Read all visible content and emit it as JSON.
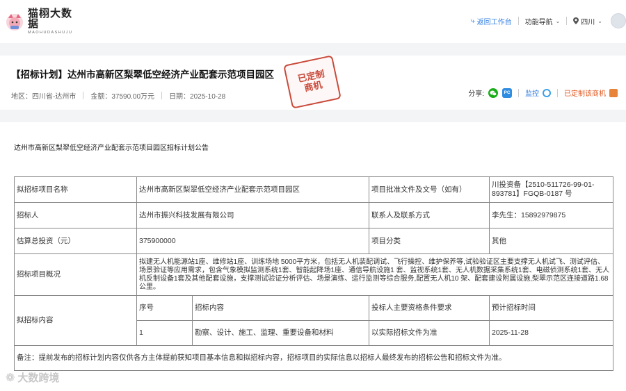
{
  "brand": {
    "name_cn": "猫栩大数据",
    "name_en": "MAOHUDASHUJU"
  },
  "topnav": {
    "back_label": "返回工作台",
    "nav_label": "功能导航",
    "region_label": "四川"
  },
  "project_header": {
    "title": "【招标计划】达州市高新区梨翠低空经济产业配套示范项目园区",
    "stamp_line1": "已定制",
    "stamp_line2": "商机",
    "region": "地区：四川省-达州市",
    "amount": "金额：37590.00万元",
    "date": "日期：2025-10-28",
    "share_label": "分享:",
    "pc_icon_text": "PC",
    "monitor_label": "监控",
    "customized_label": "已定制该商机"
  },
  "notice": {
    "title": "达州市高新区梨翠低空经济产业配套示范项目园区招标计划公告"
  },
  "table": {
    "row1": {
      "label1": "拟招标项目名称",
      "value1": "达州市高新区梨翠低空经济产业配套示范项目园区",
      "label2": "项目批准文件及文号（如有）",
      "value2": "川投资备【2510-511726-99-01-893781】FGQB-0187 号"
    },
    "row2": {
      "label1": "招标人",
      "value1": "达州市振兴科技发展有限公司",
      "label2": "联系人及联系方式",
      "value2": "李先生：15892979875"
    },
    "row3": {
      "label1": "估算总投资（元）",
      "value1": "375900000",
      "label2": "项目分类",
      "value2": "其他"
    },
    "row4": {
      "label": "招标项目概况",
      "value": "拟建无人机能源站1座、维修站1座、训练场地 5000平方米，包括无人机装配调试、飞行操控、维护保养等,试验验证区主要支撑无人机试飞、测试评估、场景验证等应用需求，包含气象模拟监测系统1套、智能起降场1座、通信导航设施1 套、监视系统1套、无人机数据采集系统1套、电磁侦测系统1套、无人机反制设备1套及其他配套设施，支撑测试验证分析评估、场景演练、运行监测等综合服务,配置无人机10 架、配套建设附属设施,梨翠示范区连接道路1.68公里。"
    },
    "row5": {
      "label": "拟招标内容",
      "headers": [
        "序号",
        "招标内容",
        "投标人主要资格条件要求",
        "预计招标时间"
      ],
      "rows": [
        [
          "1",
          "勘察、设计、施工、监理、重要设备和材料",
          "以实际招标文件为准",
          "2025-11-28"
        ]
      ]
    },
    "remark": "备注：提前发布的招标计划内容仅供各方主体提前获知项目基本信息和拟招标内容，招标项目的实际信息以招标人最终发布的招标公告和招标文件为准。"
  },
  "watermark": "大数跨境",
  "colors": {
    "accent_blue": "#2f7de1",
    "stamp_red": "#c94a3a",
    "orange": "#e35b24",
    "wechat_green": "#1aad19"
  }
}
